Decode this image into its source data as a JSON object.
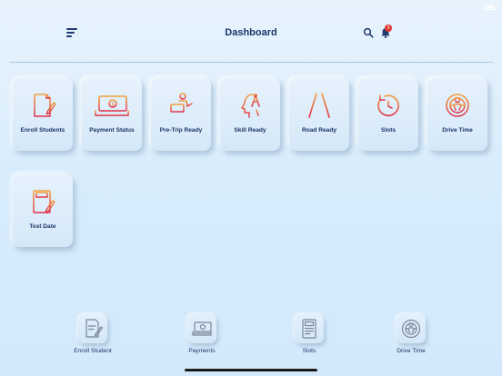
{
  "header": {
    "title": "Dashboard",
    "notification_count": "3"
  },
  "tiles": [
    {
      "label": "Enroll Students",
      "icon": "enroll-icon"
    },
    {
      "label": "Payment Status",
      "icon": "payment-icon"
    },
    {
      "label": "Pre-Trip Ready",
      "icon": "pretrip-icon"
    },
    {
      "label": "Skill Ready",
      "icon": "skill-icon"
    },
    {
      "label": "Road Ready",
      "icon": "road-icon"
    },
    {
      "label": "Slots",
      "icon": "slots-icon"
    },
    {
      "label": "Drive Time",
      "icon": "steering-wheel-icon"
    },
    {
      "label": "Test Date",
      "icon": "test-date-icon"
    }
  ],
  "bottom_nav": [
    {
      "label": "Enroll Student",
      "icon": "enroll-icon"
    },
    {
      "label": "Payments",
      "icon": "payment-icon"
    },
    {
      "label": "Slots",
      "icon": "slots-icon"
    },
    {
      "label": "Drive Time",
      "icon": "steering-wheel-icon"
    }
  ],
  "colors": {
    "accent_gradient_start": "#f2a13c",
    "accent_gradient_end": "#e0304b",
    "text_primary": "#1b3568",
    "badge": "#e0342f",
    "background": "#dcedfb"
  }
}
